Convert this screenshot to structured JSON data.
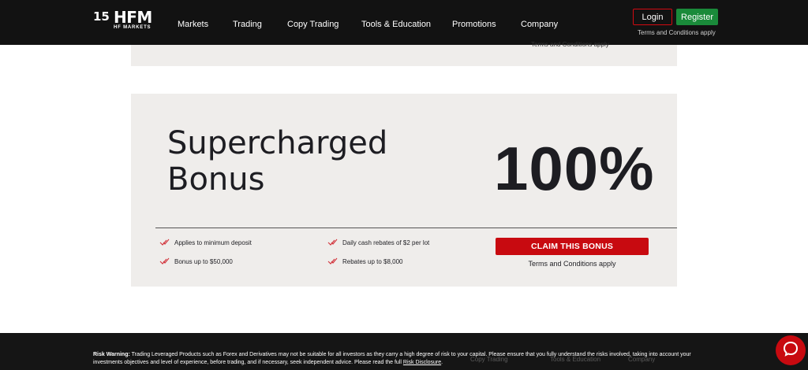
{
  "header": {
    "logo": {
      "number": "15",
      "brand": "HFM",
      "sub": "HF MARKETS"
    },
    "nav": [
      "Markets",
      "Trading",
      "Copy Trading",
      "Tools & Education",
      "Promotions",
      "Company"
    ],
    "login_label": "Login",
    "register_label": "Register",
    "terms": "Terms and Conditions apply"
  },
  "top_card": {
    "terms": "Terms and Conditions apply"
  },
  "bonus_card": {
    "title_line1": "Supercharged",
    "title_line2": "Bonus",
    "percent": "100%",
    "features": [
      "Applies to minimum deposit",
      "Daily cash rebates of $2 per lot",
      "Bonus up to $50,000",
      "Rebates up to $8,000"
    ],
    "claim_label": "CLAIM THIS BONUS",
    "terms": "Terms and Conditions apply"
  },
  "footer": {
    "ghost_nav": [
      "Copy Trading",
      "Tools & Education",
      "Company"
    ],
    "risk_label": "Risk Warning:",
    "risk_text": "Trading Leveraged Products such as Forex and Derivatives may not be suitable for all investors as they carry a high degree of risk to your capital. Please ensure that you fully understand the risks involved, taking into account your investments objectives and level of experience, before trading, and if necessary, seek independent advice. Please read the full",
    "risk_link": "Risk Disclosure",
    "risk_end": "."
  },
  "colors": {
    "accent_red": "#c80a10",
    "register_green": "#1a8a3a",
    "header_bg": "#121212",
    "card_bg": "#efedeb"
  },
  "icons": {
    "feature": "check-icon",
    "chat": "chat-icon"
  }
}
